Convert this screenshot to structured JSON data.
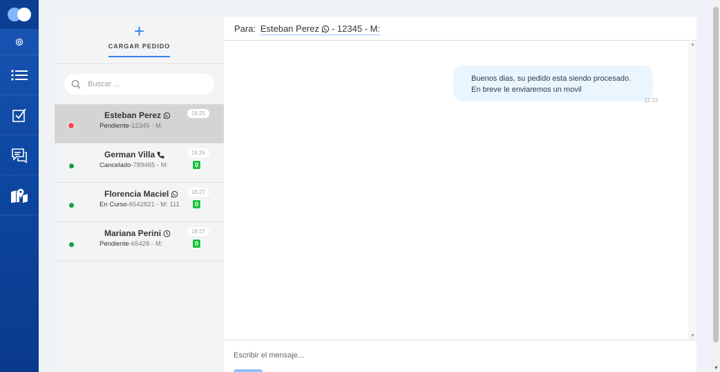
{
  "panel": {
    "add_button_label": "CARGAR PEDIDO",
    "search_placeholder": "Buscar ..."
  },
  "conversations": [
    {
      "name": "Esteban Perez",
      "channel": "whatsapp-icon",
      "status": "Pendiente",
      "detail": "-12345 - M:",
      "time": "18:25",
      "unread": "",
      "active": true
    },
    {
      "name": "German Villa",
      "channel": "phone-icon",
      "status": "Cancelado",
      "detail": "-789465 - M:",
      "time": "18:26",
      "unread": "0",
      "active": false
    },
    {
      "name": "Florencia Maciel",
      "channel": "whatsapp-icon",
      "status": "En Curso",
      "detail": "-6542821 - M: 111",
      "time": "18:27",
      "unread": "0",
      "active": false
    },
    {
      "name": "Mariana Perini",
      "channel": "clock-icon",
      "status": "Pendiente",
      "detail": "-65428 - M:",
      "time": "18:27",
      "unread": "0",
      "active": false
    }
  ],
  "chat": {
    "to_label": "Para:",
    "to_name": "Esteban Perez",
    "to_detail": "- 12345 - M:",
    "messages": [
      {
        "line1": "Buenos dias, su pedido esta siendo procesado.",
        "line2": "En breve le enviaremos un movil",
        "time": "12:23"
      }
    ],
    "composer_placeholder": "Escribir el mensaje..."
  },
  "colors": {
    "rail": "#0d47a1",
    "accent": "#2f80ed",
    "unread_badge": "#18c13c",
    "status_dot": "#1a9e3e",
    "active_dot": "#ef4b55"
  }
}
